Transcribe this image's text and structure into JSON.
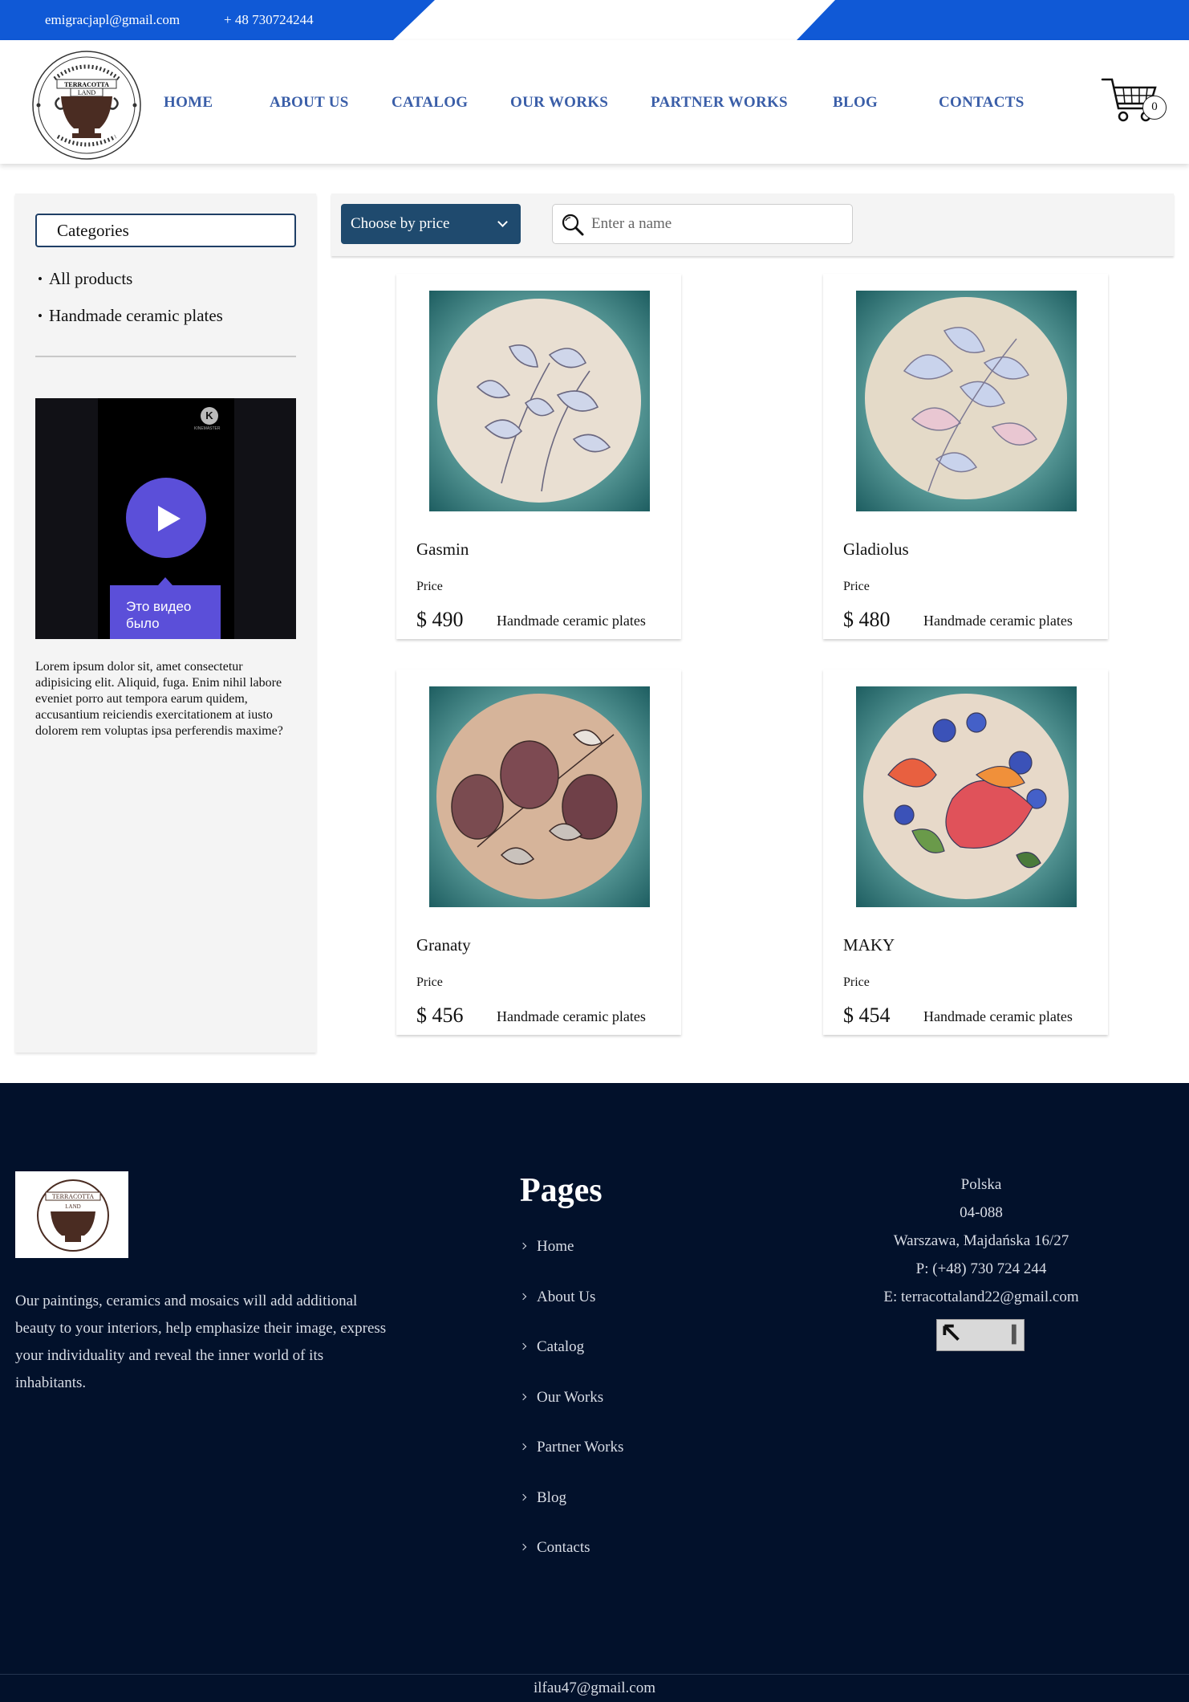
{
  "topbar": {
    "email": "emigracjapl@gmail.com",
    "phone": "+ 48 730724244"
  },
  "logo": {
    "line1": "TERRACOTTA",
    "line2": "LAND",
    "ring_text": "UKRAINE HANDMADE PRODUCTS"
  },
  "nav": {
    "items": [
      "HOME",
      "ABOUT US",
      "CATALOG",
      "OUR WORKS",
      "PARTNER WORKS",
      "BLOG",
      "CONTACTS"
    ]
  },
  "cart": {
    "count": "0"
  },
  "sidebar": {
    "categories_title": "Categories",
    "items": [
      "All products",
      "Handmade ceramic plates"
    ],
    "video": {
      "caption_line1": "Это видео",
      "caption_line2": "было",
      "brand_letter": "K",
      "brand_name": "KINEMASTER"
    },
    "lorem": "Lorem ipsum dolor sit, amet consectetur adipisicing elit. Aliquid, fuga. Enim nihil labore eveniet porro aut tempora earum quidem, accusantium reiciendis exercitationem at iusto dolorem rem voluptas ipsa perferendis maxime?"
  },
  "filters": {
    "price_select": "Choose by price",
    "search_placeholder": "Enter a name"
  },
  "products": [
    {
      "name": "Gasmin",
      "price_label": "Price",
      "price": "$ 490",
      "category": "Handmade ceramic plates"
    },
    {
      "name": "Gladiolus",
      "price_label": "Price",
      "price": "$ 480",
      "category": "Handmade ceramic plates"
    },
    {
      "name": "Granaty",
      "price_label": "Price",
      "price": "$ 456",
      "category": "Handmade ceramic plates"
    },
    {
      "name": "MAKY",
      "price_label": "Price",
      "price": "$ 454",
      "category": "Handmade ceramic plates"
    }
  ],
  "footer": {
    "logo_line1": "TERRACOTTA",
    "logo_line2": "LAND",
    "description": "Our paintings, ceramics and mosaics will add additional beauty to your interiors, help emphasize their image, express your individuality and reveal the inner world of its inhabitants.",
    "pages_title": "Pages",
    "links": [
      "Home",
      "About Us",
      "Catalog",
      "Our Works",
      "Partner Works",
      "Blog",
      "Contacts"
    ],
    "contact": {
      "country": "Polska",
      "postal": "04-088",
      "address": "Warszawa, Majdańska 16/27",
      "phone": "P: (+48) 730 724 244",
      "email": "E: terracottaland22@gmail.com"
    },
    "bottom_email": "ilfau47@gmail.com"
  },
  "colors": {
    "brand_blue": "#1059d6",
    "nav_text": "#3a5ea8",
    "select_bg": "#1f4a6e",
    "footer_bg": "#02112b",
    "video_accent": "#5b4fd9",
    "plate_teal": "#2e7b7b"
  }
}
